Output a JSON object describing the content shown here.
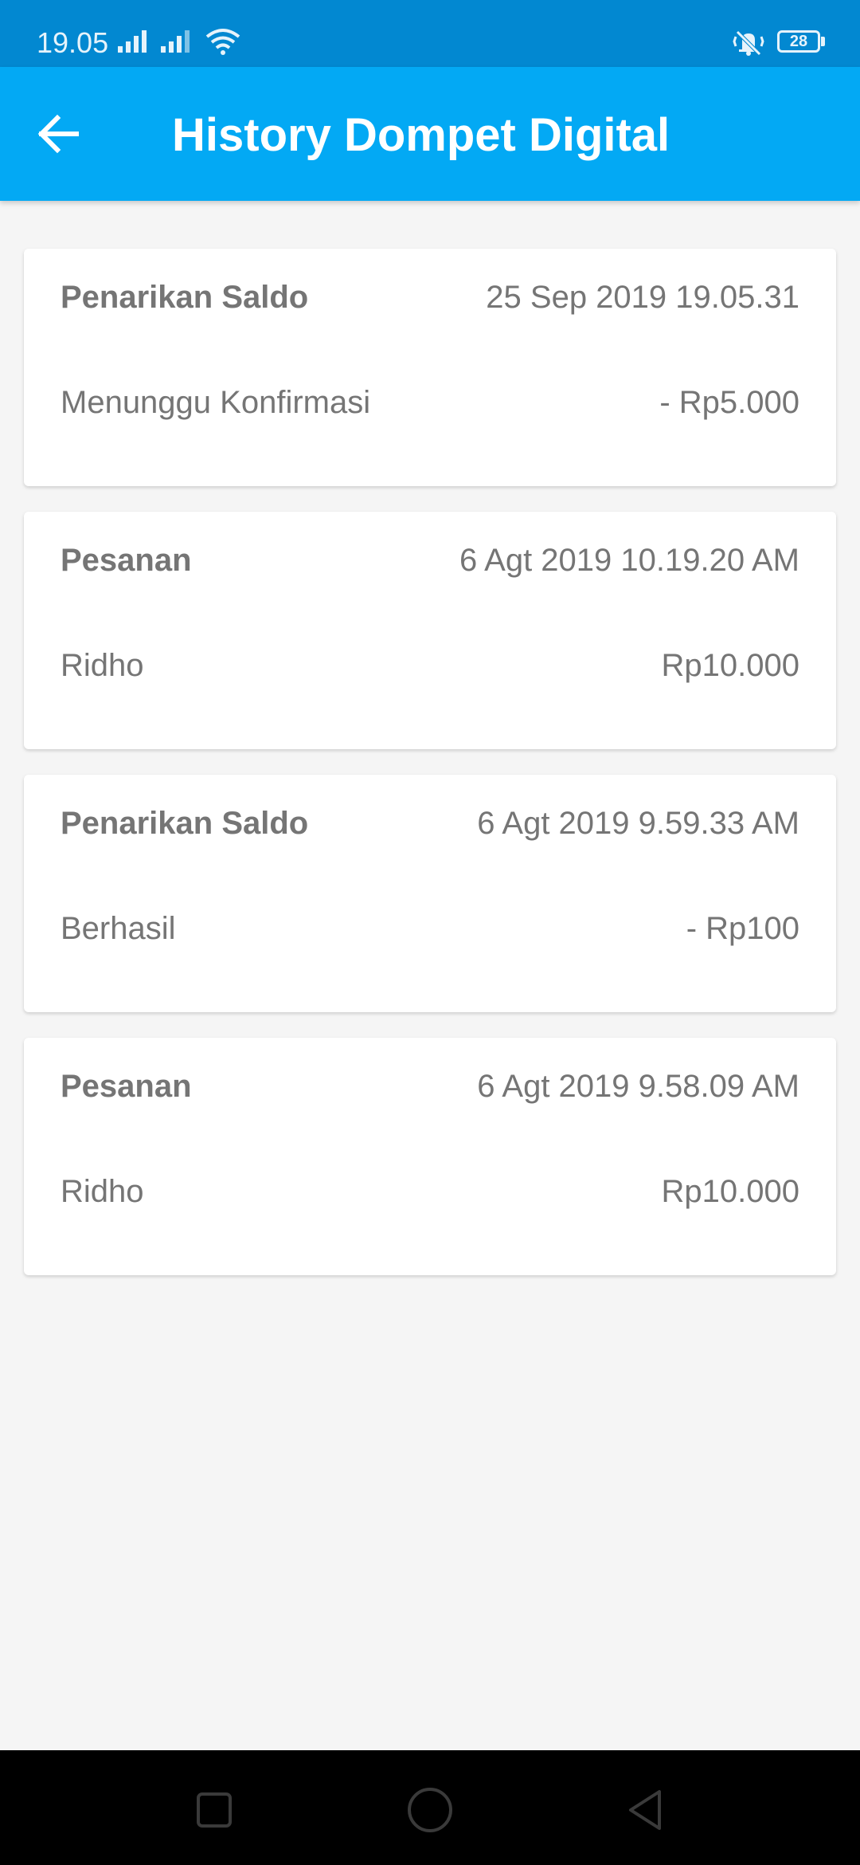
{
  "status_bar": {
    "time": "19.05",
    "battery_level": "28"
  },
  "header": {
    "title": "History Dompet Digital",
    "background": "#03a9f4",
    "status_background": "#0288d1"
  },
  "transactions": [
    {
      "type": "Penarikan Saldo",
      "date": "25 Sep 2019 19.05.31",
      "status": "Menunggu Konfirmasi",
      "amount": "- Rp5.000"
    },
    {
      "type": "Pesanan",
      "date": "6 Agt 2019 10.19.20 AM",
      "status": "Ridho",
      "amount": "Rp10.000"
    },
    {
      "type": "Penarikan Saldo",
      "date": "6 Agt 2019 9.59.33 AM",
      "status": "Berhasil",
      "amount": "- Rp100"
    },
    {
      "type": "Pesanan",
      "date": "6 Agt 2019 9.58.09 AM",
      "status": "Ridho",
      "amount": "Rp10.000"
    }
  ],
  "icons": {
    "back": "arrow-left-icon",
    "signal": "cell-signal-icon",
    "wifi": "wifi-icon",
    "vibrate": "vibrate-icon",
    "battery": "battery-icon",
    "nav_recent": "square-icon",
    "nav_home": "circle-icon",
    "nav_back": "triangle-back-icon"
  }
}
